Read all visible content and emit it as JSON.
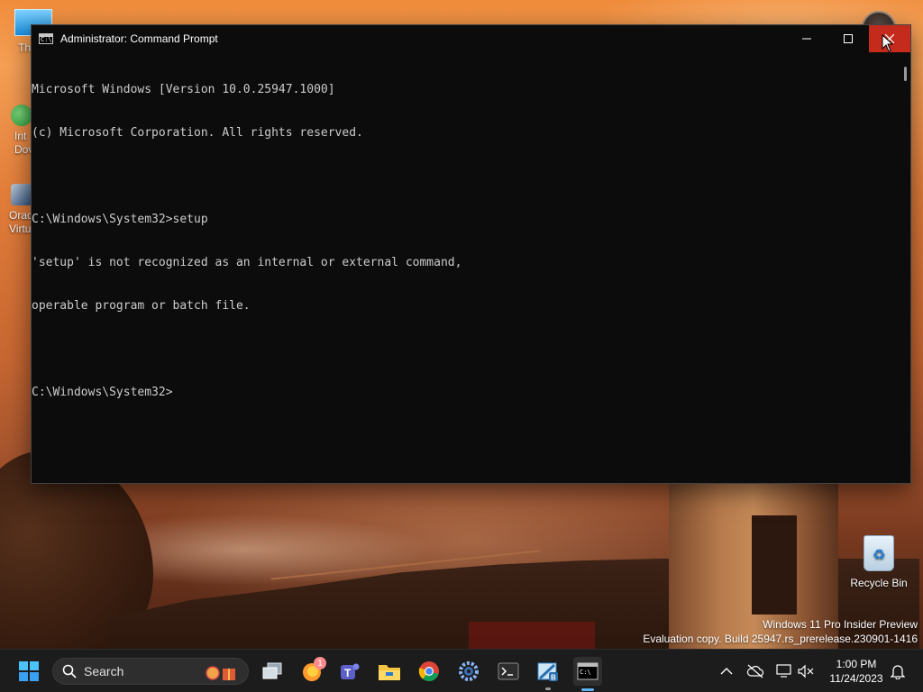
{
  "window": {
    "title": "Administrator: Command Prompt",
    "app_icon_text": "C:\\",
    "controls": {
      "minimize": "minimize",
      "maximize": "maximize",
      "close": "close"
    }
  },
  "console": {
    "lines": [
      "Microsoft Windows [Version 10.0.25947.1000]",
      "(c) Microsoft Corporation. All rights reserved.",
      "",
      "C:\\Windows\\System32>setup",
      "'setup' is not recognized as an internal or external command,",
      "operable program or batch file.",
      "",
      "C:\\Windows\\System32>"
    ]
  },
  "desktop": {
    "icons": [
      {
        "label": "Th",
        "icon": "this-pc-icon"
      },
      {
        "label": "Int\nDov",
        "icon": "internet-download-icon"
      },
      {
        "label": "Orac\nVirtu",
        "icon": "virtualbox-icon"
      }
    ],
    "recycle_bin": {
      "label": "Recycle Bin",
      "icon": "recycle-bin-icon"
    },
    "watermark": {
      "line1": "Windows 11 Pro Insider Preview",
      "line2": "Evaluation copy. Build 25947.rs_prerelease.230901-1416"
    }
  },
  "taskbar": {
    "search_label": "Search",
    "apps": [
      {
        "name": "task-view-icon"
      },
      {
        "name": "firefox-icon",
        "badge": "1"
      },
      {
        "name": "teams-icon"
      },
      {
        "name": "file-explorer-icon"
      },
      {
        "name": "chrome-icon"
      },
      {
        "name": "settings-icon"
      },
      {
        "name": "terminal-icon"
      },
      {
        "name": "hyperv-icon"
      },
      {
        "name": "command-prompt-icon",
        "active": true
      }
    ],
    "clock": {
      "time": "1:00 PM",
      "date": "11/24/2023"
    }
  },
  "colors": {
    "console_bg": "#0c0c0c",
    "console_fg": "#cccccc",
    "close_hover": "#c42b1c",
    "taskbar_bg": "#1c1c1c",
    "accent": "#5fb2f2"
  }
}
